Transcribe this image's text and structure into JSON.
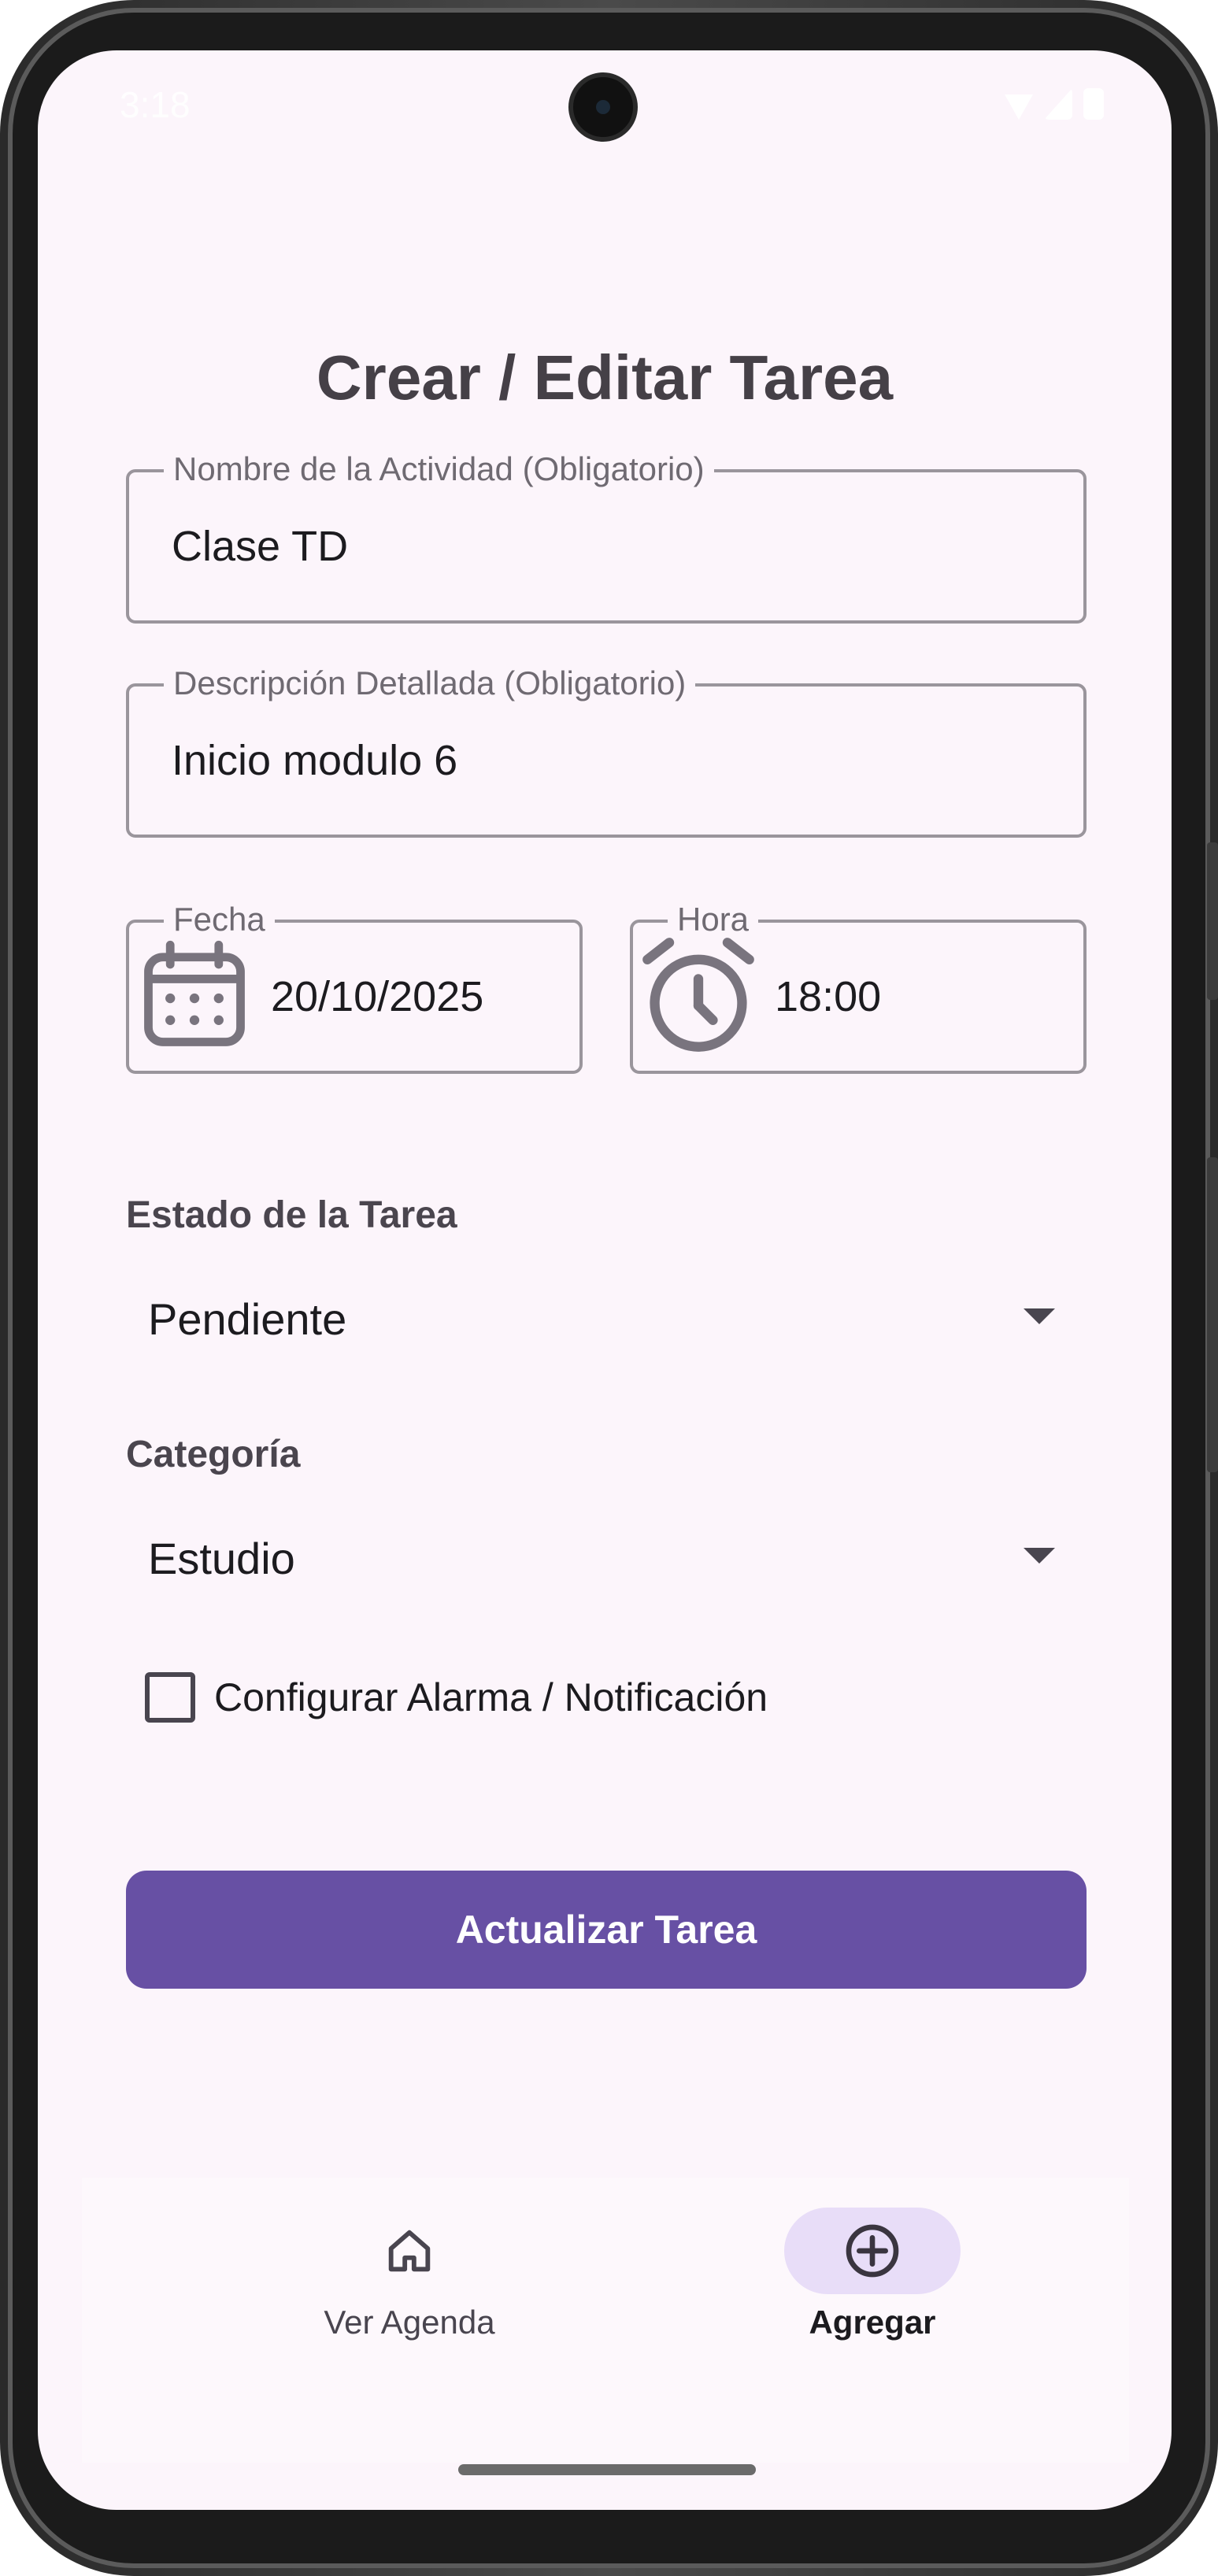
{
  "status_bar": {
    "time": "3:18"
  },
  "page": {
    "title": "Crear / Editar Tarea"
  },
  "form": {
    "activity_name": {
      "label": "Nombre de la Actividad (Obligatorio)",
      "value": "Clase TD"
    },
    "description": {
      "label": "Descripción Detallada (Obligatorio)",
      "value": "Inicio modulo 6"
    },
    "date": {
      "label": "Fecha",
      "value": "20/10/2025",
      "icon": "calendar-icon"
    },
    "time": {
      "label": "Hora",
      "value": "18:00",
      "icon": "alarm-clock-icon"
    },
    "status": {
      "label": "Estado de la Tarea",
      "selected": "Pendiente"
    },
    "category": {
      "label": "Categoría",
      "selected": "Estudio"
    },
    "alarm": {
      "label": "Configurar Alarma / Notificación",
      "checked": false
    },
    "submit_label": "Actualizar Tarea"
  },
  "bottom_nav": {
    "items": [
      {
        "label": "Ver Agenda",
        "icon": "home-icon",
        "active": false
      },
      {
        "label": "Agregar",
        "icon": "add-circle-icon",
        "active": true
      }
    ]
  },
  "colors": {
    "background": "#fcf5fb",
    "primary": "#6750a4",
    "nav_active_pill": "#e8ddf8",
    "title_text": "#454047"
  }
}
